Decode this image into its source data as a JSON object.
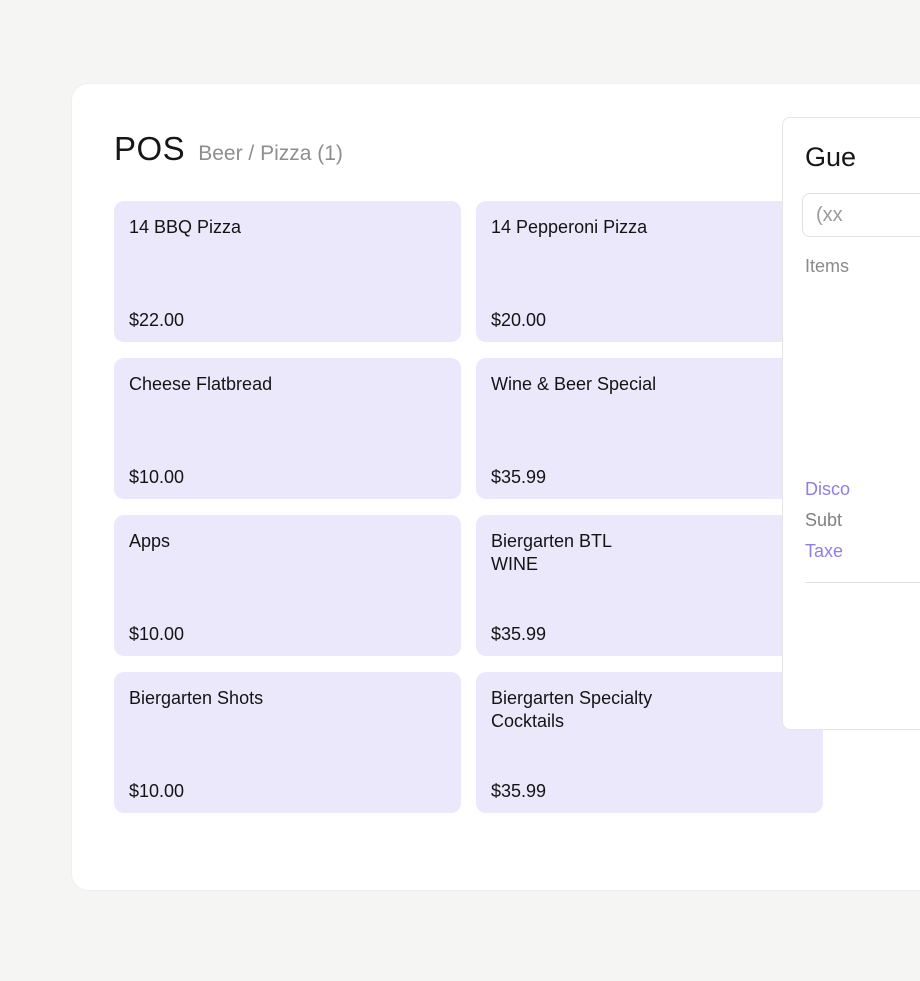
{
  "header": {
    "title": "POS",
    "breadcrumb": "Beer / Pizza (1)"
  },
  "menu_items": [
    {
      "name": "14 BBQ Pizza",
      "price": "$22.00"
    },
    {
      "name": "14 Pepperoni Pizza",
      "price": "$20.00"
    },
    {
      "name": "Cheese Flatbread",
      "price": "$10.00"
    },
    {
      "name": "Wine & Beer Special",
      "price": "$35.99"
    },
    {
      "name": "Apps",
      "price": "$10.00"
    },
    {
      "name": "Biergarten BTL\nWINE",
      "price": "$35.99"
    },
    {
      "name": "Biergarten Shots",
      "price": "$10.00"
    },
    {
      "name": "Biergarten Specialty\nCocktails",
      "price": "$35.99"
    }
  ],
  "side_panel": {
    "title": "Gue",
    "phone_placeholder": "(xx",
    "items_label": "Items",
    "discount_label": "Disco",
    "subtotal_label": "Subt",
    "taxes_label": "Taxe"
  },
  "colors": {
    "page_background": "#f5f5f3",
    "tile_background": "#ebe8fb",
    "link_accent": "#8e7fe6"
  }
}
